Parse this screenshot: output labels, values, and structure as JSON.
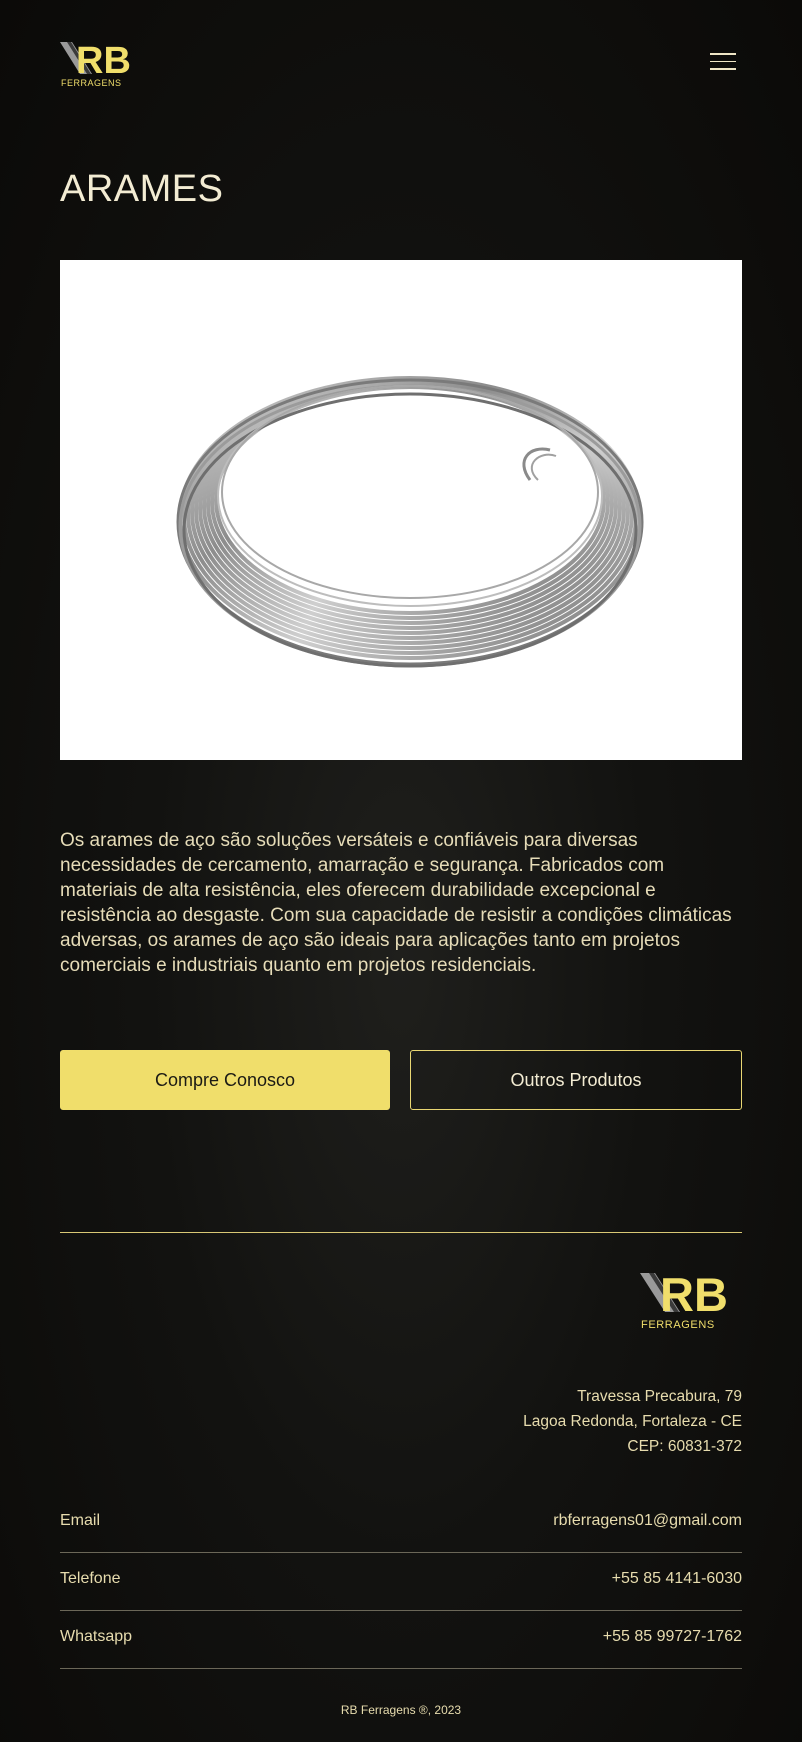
{
  "header": {
    "logo_text": "RB",
    "logo_sub": "FERRAGENS",
    "menu_icon": "hamburger-menu-icon"
  },
  "page": {
    "title": "ARAMES",
    "image_icon": "wire-coil-image",
    "description": "Os arames de aço são soluções versáteis e confiáveis para diversas necessidades de cercamento, amarração e segurança. Fabricados com materiais de alta resistência, eles oferecem durabilidade excepcional e resistência ao desgaste. Com sua capacidade de resistir a condições climáticas adversas, os arames de aço são ideais para aplicações tanto em projetos comerciais e industriais quanto em projetos residenciais."
  },
  "buttons": {
    "primary": "Compre Conosco",
    "secondary": "Outros Produtos"
  },
  "footer": {
    "logo_text": "RB",
    "logo_sub": "FERRAGENS",
    "address": {
      "line1": "Travessa Precabura, 79",
      "line2": "Lagoa Redonda, Fortaleza - CE",
      "line3": "CEP: 60831-372"
    },
    "contacts": [
      {
        "label": "Email",
        "value": "rbferragens01@gmail.com"
      },
      {
        "label": "Telefone",
        "value": "+55 85 4141-6030"
      },
      {
        "label": "Whatsapp",
        "value": "+55 85 99727-1762"
      }
    ],
    "copyright": "RB Ferragens ®, 2023"
  },
  "colors": {
    "accent": "#f0de6b",
    "background": "#0b0a08",
    "text": "#efe6c6"
  }
}
